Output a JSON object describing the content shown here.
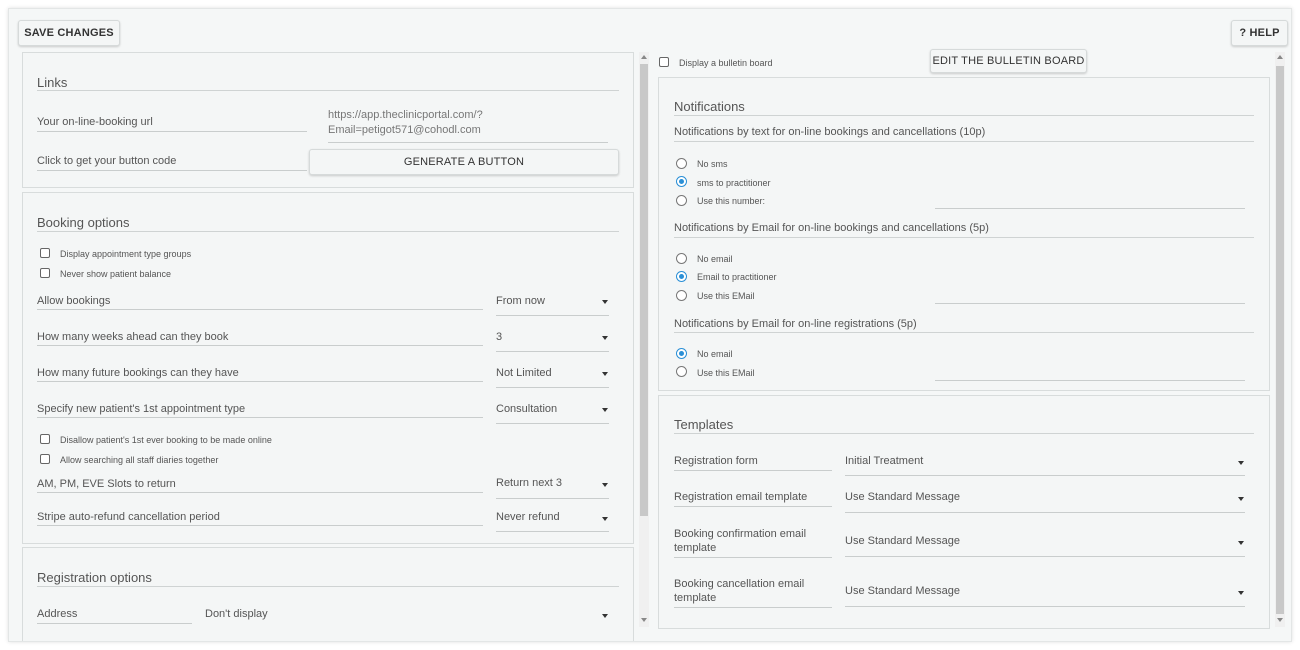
{
  "toolbar": {
    "save_label": "SAVE CHANGES",
    "help_label": "? HELP"
  },
  "links": {
    "title": "Links",
    "url_label": "Your on-line-booking url",
    "url_line1": "https://app.theclinicportal.com/?",
    "url_line2": "Email=petigot571@cohodl.com",
    "button_code_label": "Click to get your button code",
    "generate_label": "GENERATE A BUTTON"
  },
  "booking": {
    "title": "Booking options",
    "cb_groups": "Display appointment type groups",
    "cb_balance": "Never show patient balance",
    "allow_label": "Allow bookings",
    "allow_value": "From now",
    "weeks_label": "How many weeks ahead can they book",
    "weeks_value": "3",
    "future_label": "How many future bookings can they have",
    "future_value": "Not Limited",
    "first_type_label": "Specify new patient's 1st appointment type",
    "first_type_value": "Consultation",
    "cb_disallow": "Disallow patient's 1st ever booking to be made online",
    "cb_search": "Allow searching all staff diaries together",
    "slots_label": "AM, PM, EVE Slots to return",
    "slots_value": "Return next 3",
    "stripe_label": "Stripe auto-refund cancellation period",
    "stripe_value": "Never refund"
  },
  "registration": {
    "title": "Registration options",
    "address_label": "Address",
    "address_value": "Don't display"
  },
  "bulletin": {
    "checkbox_label": "Display a bulletin board",
    "edit_label": "EDIT THE BULLETIN BOARD"
  },
  "notifications": {
    "title": "Notifications",
    "text_title": "Notifications by text for on-line bookings and cancellations (10p)",
    "text_opt1": "No sms",
    "text_opt2": "sms to practitioner",
    "text_opt3": "Use this number:",
    "email_title": "Notifications by Email for on-line bookings and cancellations (5p)",
    "email_opt1": "No email",
    "email_opt2": "Email to practitioner",
    "email_opt3": "Use this EMail",
    "reg_title": "Notifications by Email for on-line registrations (5p)",
    "reg_opt1": "No email",
    "reg_opt2": "Use this EMail"
  },
  "templates": {
    "title": "Templates",
    "reg_form_label": "Registration form",
    "reg_form_value": "Initial Treatment",
    "reg_email_label": "Registration email template",
    "reg_email_value": "Use Standard Message",
    "confirm_label_1": "Booking confirmation email",
    "confirm_label_2": "template",
    "confirm_value": "Use Standard Message",
    "cancel_label_1": "Booking cancellation email",
    "cancel_label_2": "template",
    "cancel_value": "Use Standard Message"
  },
  "colors": {
    "accent": "#2a8fd6",
    "panel": "#f4f6f6",
    "background": "#f5f7f7"
  }
}
